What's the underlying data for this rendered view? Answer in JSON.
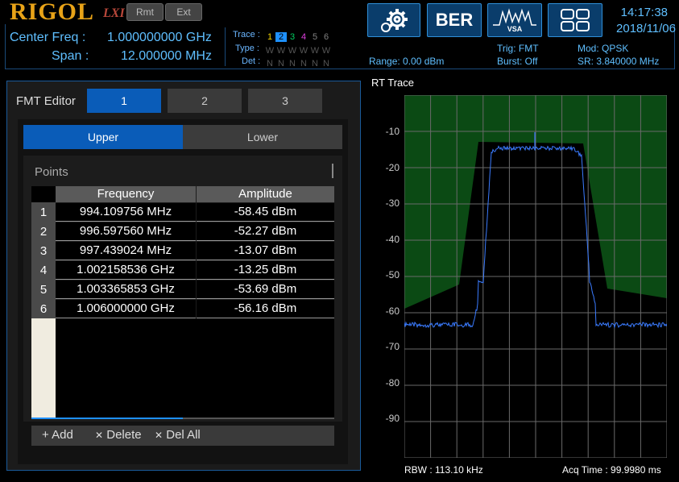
{
  "header": {
    "logo": "RIGOL",
    "lxi": "LXI",
    "rmt_label": "Rmt",
    "ext_label": "Ext",
    "center_freq_label": "Center Freq :",
    "center_freq_value": "1.000000000 GHz",
    "span_label": "Span :",
    "span_value": "12.000000 MHz",
    "trace_label": "Trace :",
    "type_label": "Type :",
    "det_label": "Det :",
    "trace_numbers": [
      "1",
      "2",
      "3",
      "4",
      "5",
      "6"
    ],
    "trace_colors": [
      "#f0d000",
      "#1e90ff",
      "#00d060",
      "#e040e0",
      "#808080",
      "#808080"
    ],
    "type_values": [
      "W",
      "W",
      "W",
      "W",
      "W",
      "W"
    ],
    "det_values": [
      "N",
      "N",
      "N",
      "N",
      "N",
      "N"
    ],
    "range": "Range: 0.00 dBm",
    "trig": "Trig: FMT",
    "burst": "Burst: Off",
    "mod": "Mod: QPSK",
    "sr": "SR: 3.840000 MHz",
    "ber_label": "BER",
    "vsa_label": "VSA",
    "time": "14:17:38",
    "date": "2018/11/06"
  },
  "fmt": {
    "title": "FMT Editor",
    "tabs": [
      "1",
      "2",
      "3"
    ],
    "upper_label": "Upper",
    "lower_label": "Lower",
    "points_label": "Points",
    "col_frequency": "Frequency",
    "col_amplitude": "Amplitude",
    "rows": [
      {
        "idx": "1",
        "freq": "994.109756 MHz",
        "amp": "-58.45 dBm"
      },
      {
        "idx": "2",
        "freq": "996.597560 MHz",
        "amp": "-52.27 dBm"
      },
      {
        "idx": "3",
        "freq": "997.439024 MHz",
        "amp": "-13.07 dBm"
      },
      {
        "idx": "4",
        "freq": "1.002158536 GHz",
        "amp": "-13.25 dBm"
      },
      {
        "idx": "5",
        "freq": "1.003365853 GHz",
        "amp": "-53.69 dBm"
      },
      {
        "idx": "6",
        "freq": "1.006000000 GHz",
        "amp": "-56.16 dBm"
      }
    ],
    "add_label": "Add",
    "delete_label": "Delete",
    "delall_label": "Del All"
  },
  "trace": {
    "title": "RT Trace",
    "y_ticks": [
      "-10",
      "-20",
      "-30",
      "-40",
      "-50",
      "-60",
      "-70",
      "-80",
      "-90"
    ],
    "rbw": "RBW : 113.10 kHz",
    "acq": "Acq Time : 99.9980 ms",
    "mask_color": "#0b4a14",
    "trace_color": "#3a7bff"
  }
}
